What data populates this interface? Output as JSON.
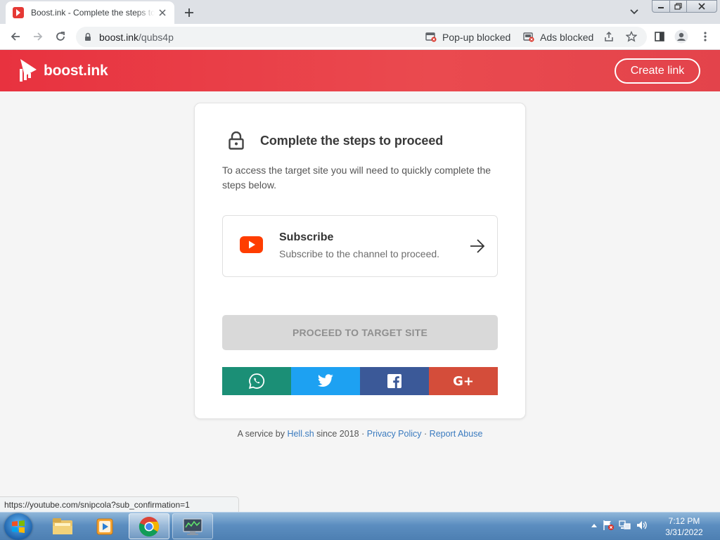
{
  "browser": {
    "tab_title": "Boost.ink - Complete the steps to proceed",
    "url_host": "boost.ink",
    "url_path": "/qubs4p",
    "popup_blocked": "Pop-up blocked",
    "ads_blocked": "Ads blocked",
    "status_url": "https://youtube.com/snipcola?sub_confirmation=1"
  },
  "site": {
    "brand": "boost.ink",
    "create_link": "Create link",
    "accent": "#e8323f"
  },
  "card": {
    "title": "Complete the steps to proceed",
    "description": "To access the target site you will need to quickly complete the steps below.",
    "step": {
      "title": "Subscribe",
      "subtitle": "Subscribe to the channel to proceed.",
      "icon": "youtube-icon"
    },
    "proceed_label": "PROCEED TO TARGET SITE",
    "share_plus": "G+"
  },
  "footer": {
    "prefix": "A service by",
    "hell_link": "Hell.sh",
    "since": "since 2018 ·",
    "privacy": "Privacy Policy",
    "sep": "·",
    "report": "Report Abuse"
  },
  "taskbar": {
    "time": "7:12 PM",
    "date": "3/31/2022"
  }
}
